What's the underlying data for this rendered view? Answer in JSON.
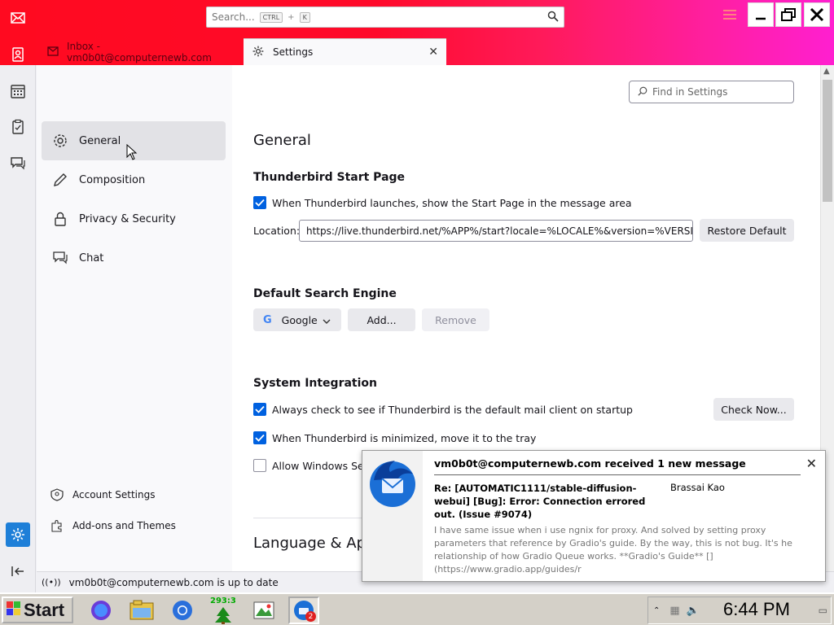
{
  "app": {
    "search_placeholder": "Search...",
    "search_kbd1": "CTRL",
    "search_plus": "+",
    "search_kbd2": "K"
  },
  "tabs": [
    {
      "label": "Inbox - vm0b0t@computernewb.com"
    },
    {
      "label": "Settings"
    }
  ],
  "sidebar": {
    "items": [
      {
        "label": "General",
        "icon": "gear-icon"
      },
      {
        "label": "Composition",
        "icon": "pencil-icon"
      },
      {
        "label": "Privacy & Security",
        "icon": "lock-icon"
      },
      {
        "label": "Chat",
        "icon": "chat-icon"
      }
    ],
    "bottom": [
      {
        "label": "Account Settings",
        "icon": "account-icon"
      },
      {
        "label": "Add-ons and Themes",
        "icon": "puzzle-icon"
      }
    ]
  },
  "settings": {
    "find_placeholder": "Find in Settings",
    "page_title": "General",
    "start_page_heading": "Thunderbird Start Page",
    "start_page_checkbox": "When Thunderbird launches, show the Start Page in the message area",
    "location_label": "Location:",
    "location_value": "https://live.thunderbird.net/%APP%/start?locale=%LOCALE%&version=%VERSIO",
    "restore_default": "Restore Default",
    "search_engine_heading": "Default Search Engine",
    "search_engine_value": "Google",
    "add_button": "Add...",
    "remove_button": "Remove",
    "system_integration_heading": "System Integration",
    "default_client_check": "Always check to see if Thunderbird is the default mail client on startup",
    "check_now": "Check Now...",
    "minimize_tray": "When Thunderbird is minimized, move it to the tray",
    "windows_search": "Allow Windows Sea",
    "language_heading": "Language & App"
  },
  "status": {
    "text": "vm0b0t@computernewb.com is up to date"
  },
  "notification": {
    "title": "vm0b0t@computernewb.com received 1 new message",
    "subject": "Re: [AUTOMATIC1111/stable-diffusion-webui] [Bug]: Error: Connection errored out. (Issue #9074)",
    "from": "Brassai Kao",
    "body": "I have same issue when i use ngnix for proxy. And solved by setting proxy parameters that reference by Gradio's guide. By the way, this is not bug. It's he relationship of how Gradio Queue works. **Gradio's Guide** [](https://www.gradio.app/guides/r"
  },
  "taskbar": {
    "start_label": "Start",
    "counter": "293:3",
    "badge": "2",
    "clock": "6:44 PM"
  },
  "colors": {
    "accent": "#0061e0",
    "titlebar": "#ff0a20"
  }
}
